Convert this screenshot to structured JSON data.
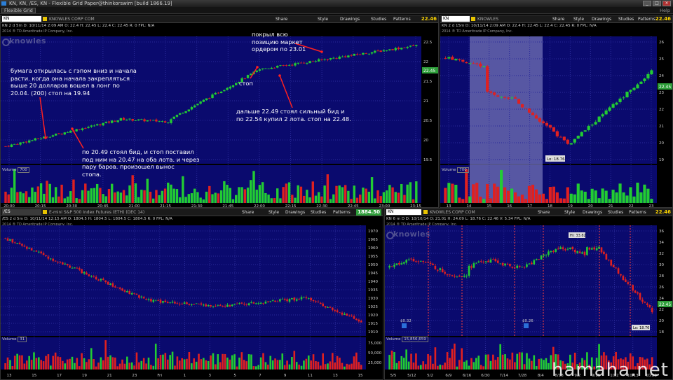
{
  "window": {
    "title": "KN, KN, /ES, KN - Flexible Grid Paper@thinkorswim [build 1866.19]",
    "tab": "Flexible Grid",
    "menu_right": "Help"
  },
  "panels": {
    "tl": {
      "symbol": "KN",
      "description": "KNOWLES CORP COM",
      "info": "KN 2 d 5m  D: 10/11/14 2:09 AM  O: 22.4  H: 22.45  L: 22.4  C: 22.45  R: 0  FPL: N/A",
      "copyright": "2014 ® TD Ameritrade IP Company, Inc.",
      "logo": "knowles",
      "price": "22.46",
      "side_price": "22.45",
      "volume_label": "Volume",
      "volume_value": "700",
      "xticks": [
        "20:00",
        "20:15",
        "20:30",
        "20:45",
        "21:00",
        "21:15",
        "21:30",
        "21:45",
        "22:00",
        "22:15",
        "22:30",
        "22:45",
        "23:00",
        "23:15"
      ],
      "yticks": [
        "22.5",
        "22",
        "21.5",
        "21",
        "20.5",
        "20",
        "19.5"
      ],
      "annotations": [
        "бумага открылась с гэпом вниз и начала\nрасти. когда  она начала закрепляться\nвыше 20 долларов вошел в лонг по\n20.04. (200) стоп на 19.94",
        "по 20.49 стоял бид, и стоп поставил\nпод ним на 20.47 на оба лота. и через\nпару баров. произошел вынос\nстопа.",
        "стоп",
        "покрыл всю\nпозицию маркет\nордером по 23.01",
        "дальше  22.49 стоял сильный бид и\nпо 22.54 купил 2 лота. стоп на 22.48."
      ]
    },
    "tr": {
      "symbol": "KN",
      "description": "KNOWLES",
      "info": "KN 2 d 15m  D: 10/11/14 2:09 AM  O: 22.4  H: 22.45  L: 22.4  C: 22.45  R: 0  FPL: N/A",
      "copyright": "2014 ® TD Ameritrade IP Company, Inc.",
      "price": "22.46",
      "side_price": "22.45",
      "lo_label": "Lo: 18.76",
      "volume_label": "Volume",
      "volume_value": "700",
      "xticks": [
        "13",
        "14",
        "15",
        "16",
        "17",
        "18",
        "19",
        "20",
        "21",
        "22",
        "23"
      ],
      "yticks": [
        "26",
        "25",
        "24",
        "23",
        "22",
        "21",
        "20",
        "19"
      ]
    },
    "bl": {
      "symbol": "/ES",
      "description": "E-mini S&P 500 Index Futures (ETH) (DEC 14)",
      "info": "/ES 2 d 5m  D: 10/11/14 12:15 AM  O: 1804.5  H: 1804.5  L: 1804.5  C: 1804.5  R: 0  FPL: N/A",
      "copyright": "2014 ® TD Ameritrade IP Company, Inc.",
      "price": "1884.50",
      "volume_label": "Volume",
      "volume_value": "31",
      "xticks": [
        "13",
        "15",
        "17",
        "19",
        "21",
        "23",
        "Fri",
        "1",
        "3",
        "5",
        "7",
        "9",
        "11",
        "13",
        "15"
      ],
      "yticks": [
        "1970",
        "1965",
        "1960",
        "1955",
        "1950",
        "1945",
        "1940",
        "1935",
        "1930",
        "1925",
        "1920",
        "1915",
        "1910"
      ],
      "vol_ticks": [
        "75,000",
        "50,000",
        "25,000"
      ]
    },
    "br": {
      "symbol": "KN",
      "description": "KNOWLES CORP COM",
      "info": "KN 6 m D  D: 10/10/14  O: 21.01  H: 24.09  L: 18.76  C: 22.46  V: 5.34  FPL: N/A",
      "copyright": "2014 ® TD Ameritrade IP Company, Inc.",
      "logo": "knowles",
      "price": "22.46",
      "side_price": "22.45",
      "hi_label": "Hi: 33.82",
      "lo_label": "Lo: 18.76",
      "volume_label": "Volume",
      "volume_value": "15,856,659",
      "div_labels": [
        "$0.32",
        "$0.26"
      ],
      "xticks": [
        "5/5",
        "5/12",
        "5/2",
        "6/9",
        "6/16",
        "6/30",
        "7/14",
        "7/28",
        "8/4",
        "8/18",
        "9/2",
        "9/15",
        "10/2",
        "10/13",
        "10/20"
      ],
      "yticks": [
        "36",
        "34",
        "32",
        "30",
        "28",
        "26",
        "24",
        "22",
        "20",
        "18"
      ]
    }
  },
  "toolbar": {
    "share": "Share",
    "style": "Style",
    "drawings": "Drawings",
    "studies": "Studies",
    "patterns": "Patterns"
  },
  "watermark": "hamaha.net",
  "colors": {
    "bg": "#0a0a6e",
    "up": "#22cc33",
    "down": "#e02020",
    "shade": "#6a6ab0",
    "note": "#ffffff"
  }
}
